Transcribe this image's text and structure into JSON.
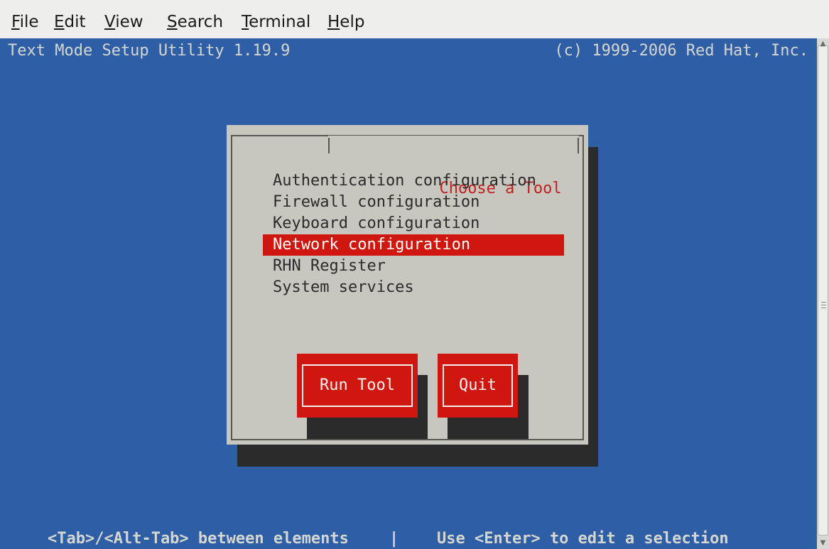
{
  "menubar": {
    "items": [
      "File",
      "Edit",
      "View",
      "Search",
      "Terminal",
      "Help"
    ]
  },
  "terminal": {
    "header_left": "Text Mode Setup Utility 1.19.9",
    "header_right": "(c) 1999-2006 Red Hat, Inc."
  },
  "dialog": {
    "title": "Choose a Tool",
    "tools": [
      "Authentication configuration",
      "Firewall configuration",
      "Keyboard configuration",
      "Network configuration",
      "RHN Register",
      "System services"
    ],
    "selected_tool": "Network configuration",
    "run_label": "Run Tool",
    "quit_label": "Quit"
  },
  "statusbar": {
    "left": "<Tab>/<Alt-Tab> between elements",
    "separator": "|",
    "right": "Use <Enter> to edit a selection"
  },
  "icons": {
    "scroll_up": "scroll-up-arrow-icon",
    "scroll_down": "scroll-down-arrow-icon"
  },
  "colors": {
    "terminal_bg": "#2e5fa6",
    "dialog_bg": "#c7c6bf",
    "accent_red": "#d0170f",
    "title_red": "#c4201e"
  }
}
